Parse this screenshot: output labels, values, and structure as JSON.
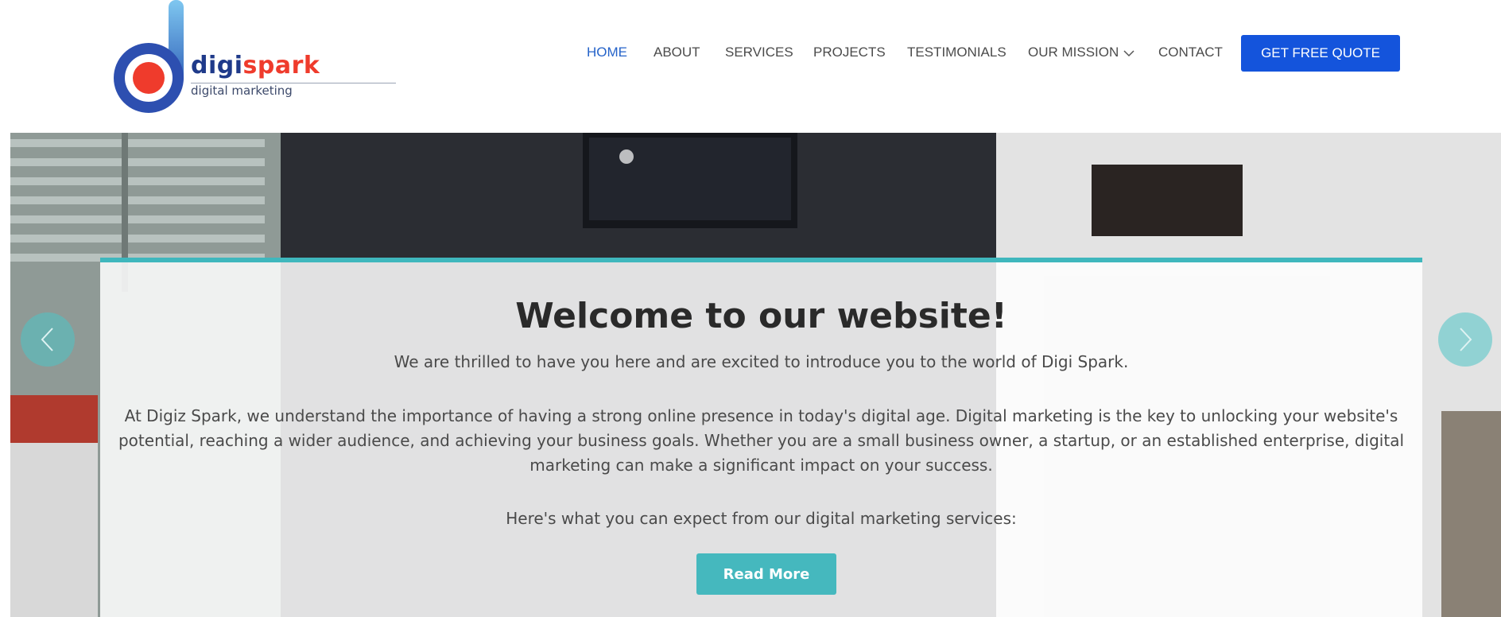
{
  "brand": {
    "name_part1": "digi",
    "name_part2": "spark",
    "tagline": "digital marketing",
    "colors": {
      "primary": "#1f3a8a",
      "accent": "#ef3b2c",
      "light": "#5aa9e6"
    }
  },
  "nav": {
    "items": [
      {
        "label": "HOME",
        "active": true
      },
      {
        "label": "ABOUT"
      },
      {
        "label": "SERVICES"
      },
      {
        "label": "PROJECTS"
      },
      {
        "label": "TESTIMONIALS"
      },
      {
        "label": "OUR MISSION",
        "icon": "chevron-down-icon"
      },
      {
        "label": "CONTACT"
      }
    ],
    "cta": "GET FREE QUOTE",
    "active_color": "#2563c9",
    "cta_color": "#1454dc"
  },
  "hero": {
    "title": "Welcome to our website!",
    "paragraph1": "We are thrilled to have you here and are excited to introduce you to the world of Digi Spark.",
    "paragraph2": "At Digiz Spark, we understand the importance of having a strong online presence in today's digital age. Digital marketing is the key to unlocking your website's potential, reaching a wider audience, and achieving your business goals. Whether you are a small business owner, a startup, or an established enterprise, digital marketing can make a significant impact on your success.",
    "paragraph3": "Here's what you can expect from our digital marketing services:",
    "button": "Read More",
    "prev_icon": "chevron-left-icon",
    "next_icon": "chevron-right-icon",
    "accent_color": "#3fb7bd"
  }
}
